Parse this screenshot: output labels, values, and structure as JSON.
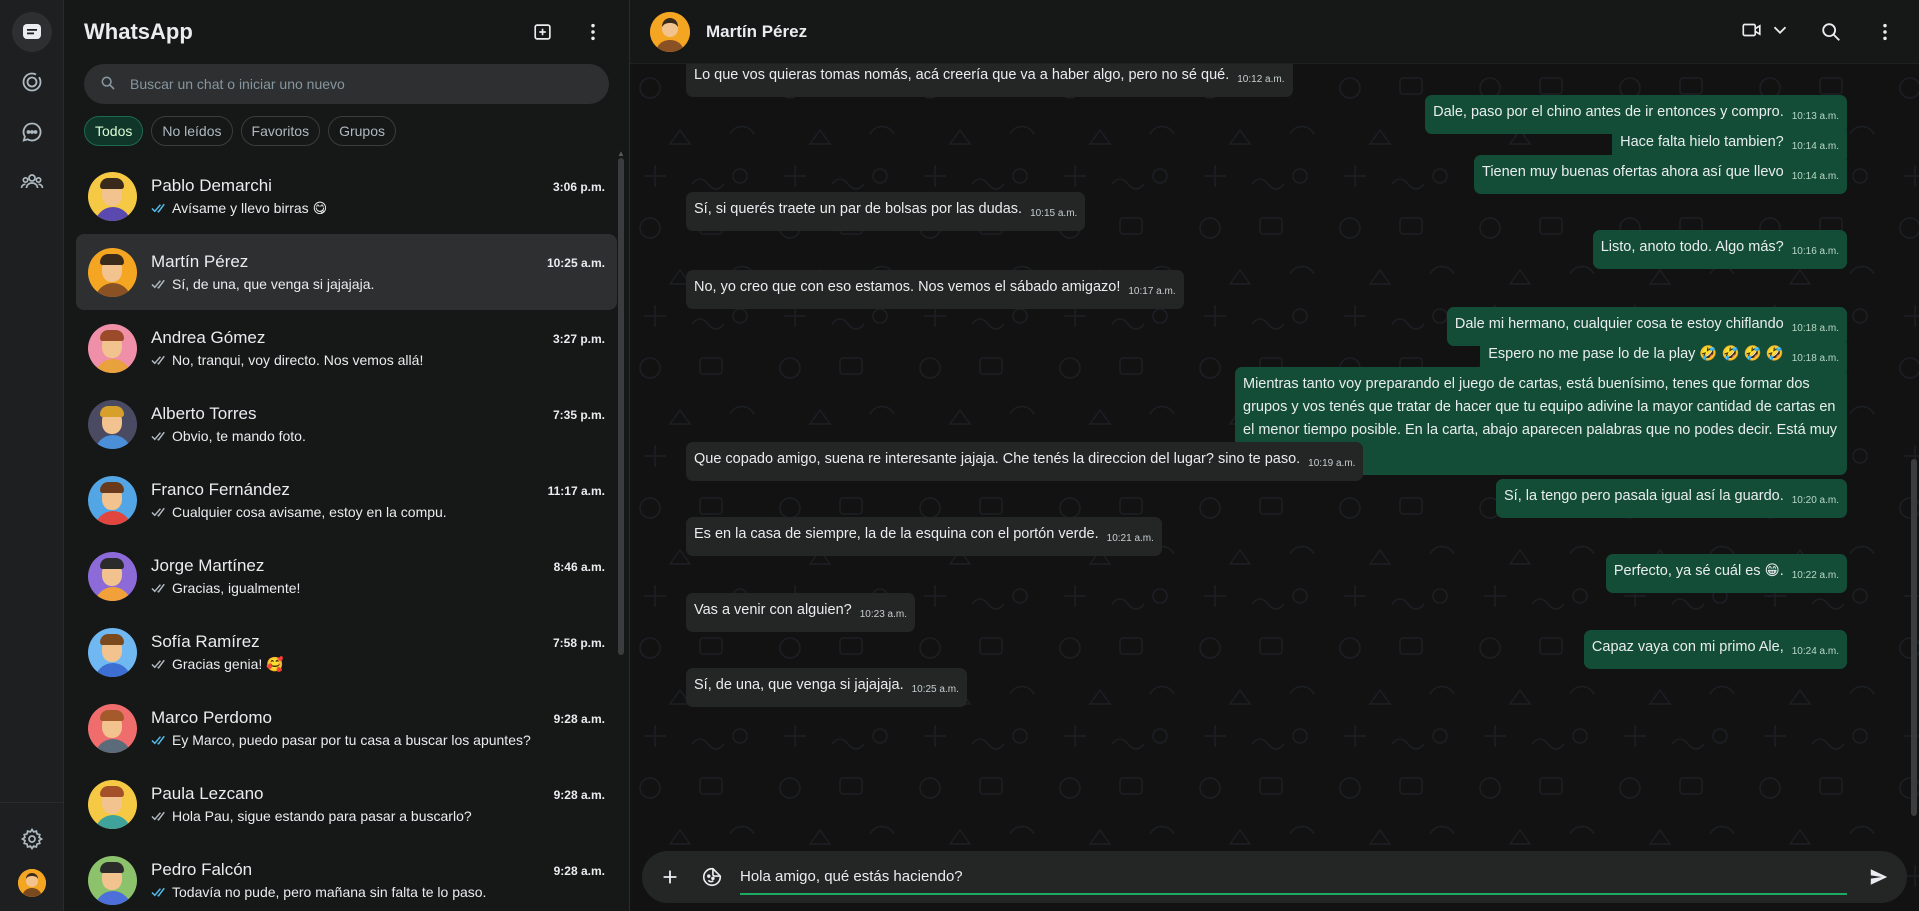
{
  "app": {
    "title": "WhatsApp"
  },
  "search": {
    "placeholder": "Buscar un chat o iniciar uno nuevo"
  },
  "filters": [
    "Todos",
    "No leídos",
    "Favoritos",
    "Grupos"
  ],
  "chats": [
    {
      "name": "Pablo Demarchi",
      "time": "3:06 p.m.",
      "preview": "Avísame y llevo birras 😋",
      "read": true
    },
    {
      "name": "Martín Pérez",
      "time": "10:25 a.m.",
      "preview": "Sí, de una, que venga si jajajaja.",
      "read": false
    },
    {
      "name": "Andrea Gómez",
      "time": "3:27 p.m.",
      "preview": "No, tranqui, voy directo. Nos vemos allá!",
      "read": false
    },
    {
      "name": "Alberto Torres",
      "time": "7:35 p.m.",
      "preview": "Obvio, te mando foto.",
      "read": false
    },
    {
      "name": "Franco Fernández",
      "time": "11:17 a.m.",
      "preview": "Cualquier cosa avisame, estoy en la compu.",
      "read": false
    },
    {
      "name": "Jorge Martínez",
      "time": "8:46 a.m.",
      "preview": "Gracias, igualmente!",
      "read": false
    },
    {
      "name": "Sofía Ramírez",
      "time": "7:58 p.m.",
      "preview": "Gracias genia! 🥰",
      "read": false
    },
    {
      "name": "Marco Perdomo",
      "time": "9:28 a.m.",
      "preview": "Ey Marco, puedo pasar por tu casa a buscar los apuntes?",
      "read": true
    },
    {
      "name": "Paula Lezcano",
      "time": "9:28 a.m.",
      "preview": "Hola Pau, sigue estando para pasar a buscarlo?",
      "read": false
    },
    {
      "name": "Pedro Falcón",
      "time": "9:28 a.m.",
      "preview": "Todavía no pude, pero mañana sin falta te lo paso.",
      "read": true
    }
  ],
  "conversation": {
    "contact_name": "Martín Pérez",
    "messages": [
      {
        "dir": "in",
        "text": "Lo que vos quieras tomas nomás, acá creería que va a haber algo, pero no sé qué.",
        "time": "10:12 a.m."
      },
      {
        "dir": "out",
        "text": "Dale, paso por el chino antes de ir entonces y compro.",
        "time": "10:13 a.m."
      },
      {
        "dir": "out",
        "text": "Hace falta hielo tambien?",
        "time": "10:14 a.m."
      },
      {
        "dir": "out",
        "text": "Tienen muy buenas ofertas ahora así que llevo",
        "time": "10:14 a.m."
      },
      {
        "dir": "in",
        "text": "Sí, si querés traete un par de bolsas por las dudas.",
        "time": "10:15 a.m."
      },
      {
        "dir": "out",
        "text": "Listo, anoto todo. Algo más?",
        "time": "10:16 a.m."
      },
      {
        "dir": "in",
        "text": "No, yo creo que con eso estamos. Nos vemos el sábado amigazo!",
        "time": "10:17 a.m."
      },
      {
        "dir": "out",
        "text": "Dale mi hermano, cualquier cosa te estoy chiflando",
        "time": "10:18 a.m."
      },
      {
        "dir": "out",
        "text": "Espero no me pase lo de la play 🤣 🤣 🤣 🤣",
        "time": "10:18 a.m."
      },
      {
        "dir": "out",
        "text": "Mientras tanto voy preparando el juego de cartas, está buenísimo, tenes que formar dos grupos y vos tenés que tratar de hacer que tu equipo adivine la mayor cantidad de cartas en el menor tiempo posible. En la carta, abajo aparecen palabras que no podes decir. Está muy bueno!!",
        "time": "10:18 a.m."
      },
      {
        "dir": "in",
        "text": "Que copado amigo, suena re interesante jajaja. Che tenés la direccion del lugar? sino te paso.",
        "time": "10:19 a.m."
      },
      {
        "dir": "out",
        "text": "Sí, la tengo pero pasala igual así la guardo.",
        "time": "10:20 a.m."
      },
      {
        "dir": "in",
        "text": "Es en la casa de siempre, la de la esquina con el portón verde.",
        "time": "10:21 a.m."
      },
      {
        "dir": "out",
        "text": "Perfecto, ya sé cuál es 😁.",
        "time": "10:22 a.m."
      },
      {
        "dir": "in",
        "text": "Vas a venir con alguien?",
        "time": "10:23 a.m."
      },
      {
        "dir": "out",
        "text": "Capaz vaya con mi primo Ale,",
        "time": "10:24 a.m."
      },
      {
        "dir": "in",
        "text": "Sí, de una, que venga si jajajaja.",
        "time": "10:25 a.m."
      }
    ]
  },
  "composer": {
    "value": "Hola amigo, qué estás haciendo?"
  },
  "icons": {
    "rail": [
      "chats-icon",
      "status-icon",
      "channels-icon",
      "communities-icon",
      "settings-icon"
    ],
    "header": [
      "new-chat-icon",
      "menu-icon",
      "video-call-icon",
      "chevron-down-icon",
      "search-icon",
      "menu-icon"
    ],
    "composer": [
      "plus-icon",
      "sticker-icon",
      "send-icon"
    ]
  },
  "colors": {
    "accent": "#1daa61",
    "outgoing_bubble": "#144d37",
    "incoming_bubble": "#242626",
    "background": "#161717"
  }
}
